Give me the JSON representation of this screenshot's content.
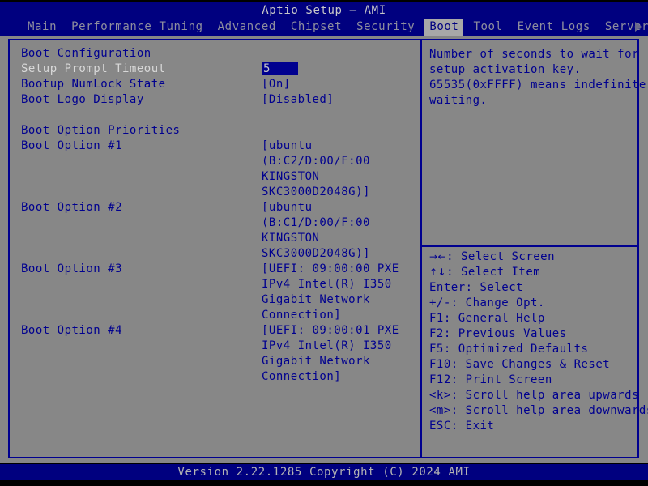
{
  "titlebar": {
    "title": "Aptio Setup – AMI"
  },
  "menubar": {
    "items": [
      {
        "label": "Main",
        "active": false
      },
      {
        "label": "Performance Tuning",
        "active": false
      },
      {
        "label": "Advanced",
        "active": false
      },
      {
        "label": "Chipset",
        "active": false
      },
      {
        "label": "Security",
        "active": false
      },
      {
        "label": "Boot",
        "active": true
      },
      {
        "label": "Tool",
        "active": false
      },
      {
        "label": "Event Logs",
        "active": false
      },
      {
        "label": "Server Mgmt",
        "active": false
      }
    ],
    "overflow_icon": "triangle-right-icon"
  },
  "settings": {
    "section_boot_config": "Boot Configuration",
    "rows": [
      {
        "label": "Setup Prompt Timeout",
        "value": "5",
        "boxed": true,
        "selected": true
      },
      {
        "label": "Bootup NumLock State",
        "value": "[On]",
        "boxed": false,
        "selected": false
      },
      {
        "label": "Boot Logo Display",
        "value": "[Disabled]",
        "boxed": false,
        "selected": false
      }
    ],
    "section_boot_priorities": "Boot Option Priorities",
    "boot_options": [
      {
        "label": "Boot Option #1",
        "value_lines": [
          "[ubuntu",
          "(B:C2/D:00/F:00",
          "KINGSTON",
          "SKC3000D2048G)]"
        ]
      },
      {
        "label": "Boot Option #2",
        "value_lines": [
          "[ubuntu",
          "(B:C1/D:00/F:00",
          "KINGSTON",
          "SKC3000D2048G)]"
        ]
      },
      {
        "label": "Boot Option #3",
        "value_lines": [
          "[UEFI: 09:00:00 PXE",
          "IPv4 Intel(R) I350",
          "Gigabit Network",
          "Connection]"
        ]
      },
      {
        "label": "Boot Option #4",
        "value_lines": [
          "[UEFI: 09:00:01 PXE",
          "IPv4 Intel(R) I350",
          "Gigabit Network",
          "Connection]"
        ]
      }
    ]
  },
  "help": {
    "lines": [
      "Number of seconds to wait for",
      "setup activation key.",
      "65535(0xFFFF) means indefinite",
      "waiting."
    ]
  },
  "keys": {
    "lines": [
      {
        "glyph": "→←",
        "text": ": Select Screen"
      },
      {
        "glyph": "↑↓",
        "text": ": Select Item"
      },
      {
        "glyph": "",
        "text": "Enter: Select"
      },
      {
        "glyph": "",
        "text": "+/-: Change Opt."
      },
      {
        "glyph": "",
        "text": "F1: General Help"
      },
      {
        "glyph": "",
        "text": "F2: Previous Values"
      },
      {
        "glyph": "",
        "text": "F5: Optimized Defaults"
      },
      {
        "glyph": "",
        "text": "F10: Save Changes & Reset"
      },
      {
        "glyph": "",
        "text": "F12: Print Screen"
      },
      {
        "glyph": "",
        "text": "<k>: Scroll help area upwards"
      },
      {
        "glyph": "",
        "text": "<m>: Scroll help area downwards"
      },
      {
        "glyph": "",
        "text": "ESC: Exit"
      }
    ]
  },
  "footer": {
    "text": "Version 2.22.1285 Copyright (C) 2024 AMI"
  },
  "colors": {
    "background": "#878787",
    "chrome_blue": "#00007f",
    "text_blue": "#00008f",
    "text_light": "#c8c8c8",
    "menu_inactive": "#8e8e9e",
    "menu_active_bg": "#a8a8a8"
  }
}
